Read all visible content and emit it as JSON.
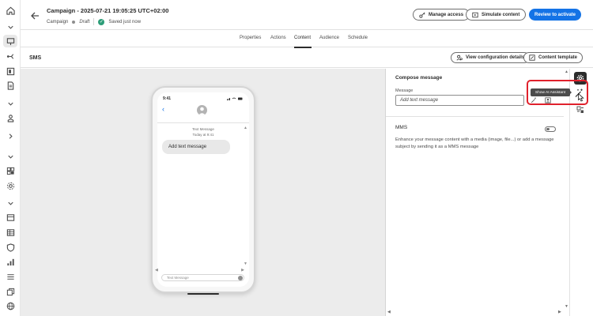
{
  "header": {
    "title": "Campaign - 2025-07-21 19:05:25 UTC+02:00",
    "type_label": "Campaign",
    "status": "Draft",
    "saved_status": "Saved just now",
    "manage_access_label": "Manage access",
    "simulate_label": "Simulate content",
    "review_label": "Review to activate"
  },
  "tabs": [
    "Properties",
    "Actions",
    "Content",
    "Audience",
    "Schedule"
  ],
  "active_tab": "Content",
  "toolbar": {
    "channel_label": "SMS",
    "view_config_label": "View configuration details",
    "content_template_label": "Content template"
  },
  "phone": {
    "time": "9:41",
    "meta_line1": "Text Message",
    "meta_line2": "Today at 9:41",
    "bubble_text": "Add text message",
    "compose_placeholder": "Text Message"
  },
  "panel": {
    "title": "Compose message",
    "message_label": "Message",
    "message_placeholder": "Add text message",
    "mms_title": "MMS",
    "mms_description": "Enhance your message content with a media (image, file...) or add a message subject by sending it as a MMS message",
    "mms_enabled": false
  },
  "tooltip": {
    "text": "Show AI Assistant"
  },
  "colors": {
    "accent": "#1473e6",
    "highlight": "#e0212c",
    "success": "#2d9d78"
  }
}
